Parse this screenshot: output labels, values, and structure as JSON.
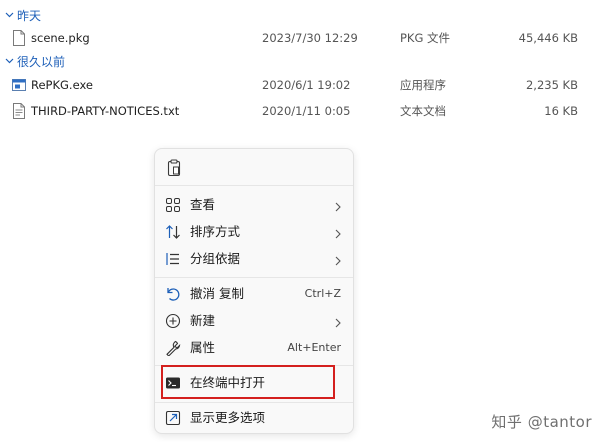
{
  "groups": [
    {
      "label": "昨天",
      "files": [
        {
          "name": "scene.pkg",
          "date": "2023/7/30 12:29",
          "type": "PKG 文件",
          "size": "45,446 KB",
          "icon": "file-icon"
        }
      ]
    },
    {
      "label": "很久以前",
      "files": [
        {
          "name": "RePKG.exe",
          "date": "2020/6/1 19:02",
          "type": "应用程序",
          "size": "2,235 KB",
          "icon": "exe-icon"
        },
        {
          "name": "THIRD-PARTY-NOTICES.txt",
          "date": "2020/1/11 0:05",
          "type": "文本文档",
          "size": "16 KB",
          "icon": "text-file-icon"
        }
      ]
    }
  ],
  "context_menu": {
    "top_icon": "paste-icon",
    "items": [
      {
        "label": "查看",
        "icon": "grid-view-icon",
        "submenu": true
      },
      {
        "label": "排序方式",
        "icon": "sort-icon",
        "submenu": true
      },
      {
        "label": "分组依据",
        "icon": "group-icon",
        "submenu": true
      },
      {
        "label": "撤消 复制",
        "icon": "undo-icon",
        "shortcut": "Ctrl+Z"
      },
      {
        "label": "新建",
        "icon": "new-plus-icon",
        "submenu": true
      },
      {
        "label": "属性",
        "icon": "wrench-icon",
        "shortcut": "Alt+Enter"
      },
      {
        "label": "在终端中打开",
        "icon": "terminal-icon",
        "highlighted": true
      },
      {
        "label": "显示更多选项",
        "icon": "more-options-icon"
      }
    ]
  },
  "watermark": "知乎 @tantor",
  "colors": {
    "accent": "#1d5fb8",
    "highlight": "#d4201e"
  }
}
